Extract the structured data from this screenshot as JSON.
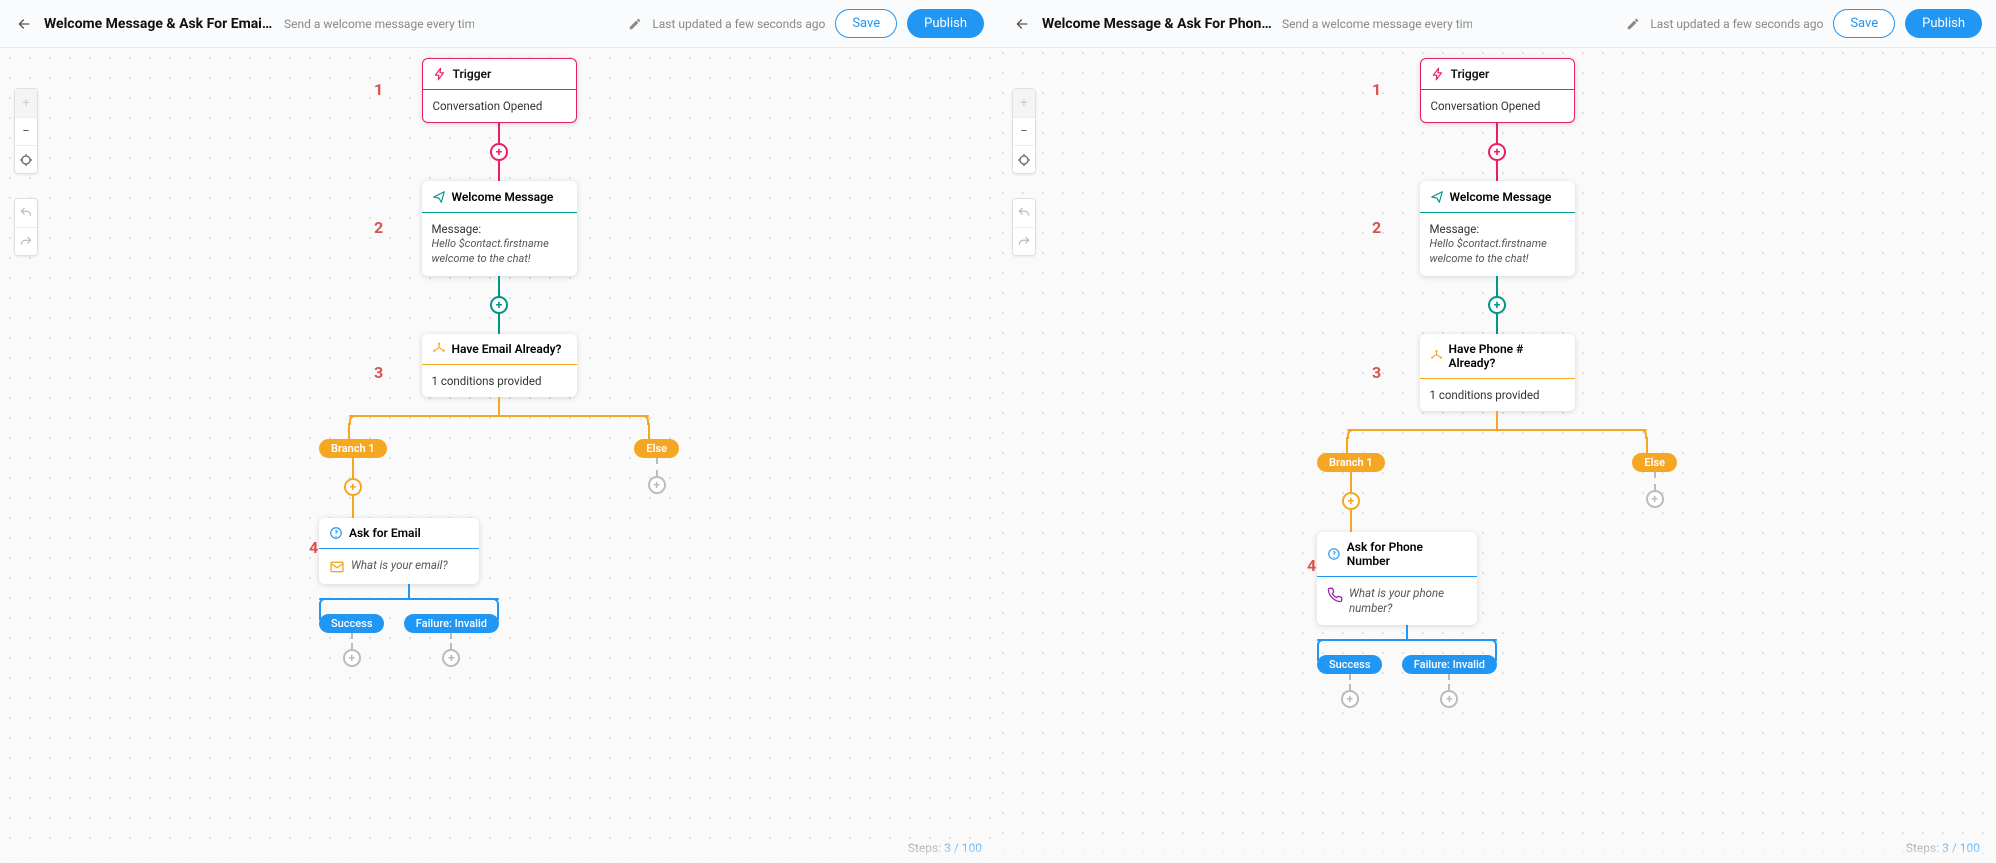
{
  "panels": [
    {
      "header": {
        "title": "Welcome Message & Ask For Email ...",
        "subtitle": "Send a welcome message every time a ...",
        "updated": "Last updated a few seconds ago",
        "save": "Save",
        "publish": "Publish"
      },
      "steps": {
        "s1": {
          "num": "1",
          "title": "Trigger",
          "body": "Conversation Opened"
        },
        "s2": {
          "num": "2",
          "title": "Welcome Message",
          "label": "Message:",
          "msg": "Hello $contact.firstname welcome to the chat!"
        },
        "s3": {
          "num": "3",
          "title": "Have Email Already?",
          "body": "1 conditions provided"
        },
        "s4": {
          "num": "4",
          "title": "Ask for Email",
          "question": "What is your email?",
          "icon": "mail"
        }
      },
      "branches": {
        "a": "Branch 1",
        "b": "Else"
      },
      "outcomes": {
        "a": "Success",
        "b": "Failure: Invalid"
      },
      "footer": {
        "prefix": "Steps: ",
        "count": "3 / 100"
      }
    },
    {
      "header": {
        "title": "Welcome Message & Ask For Phone...",
        "subtitle": "Send a welcome message every time a ...",
        "updated": "Last updated a few seconds ago",
        "save": "Save",
        "publish": "Publish"
      },
      "steps": {
        "s1": {
          "num": "1",
          "title": "Trigger",
          "body": "Conversation Opened"
        },
        "s2": {
          "num": "2",
          "title": "Welcome Message",
          "label": "Message:",
          "msg": "Hello $contact.firstname welcome to the chat!"
        },
        "s3": {
          "num": "3",
          "title": "Have Phone # Already?",
          "body": "1 conditions provided"
        },
        "s4": {
          "num": "4",
          "title": "Ask for Phone Number",
          "question": "What is your phone number?",
          "icon": "phone"
        }
      },
      "branches": {
        "a": "Branch 1",
        "b": "Else"
      },
      "outcomes": {
        "a": "Success",
        "b": "Failure: Invalid"
      },
      "footer": {
        "prefix": "Steps: ",
        "count": "3 / 100"
      }
    }
  ]
}
